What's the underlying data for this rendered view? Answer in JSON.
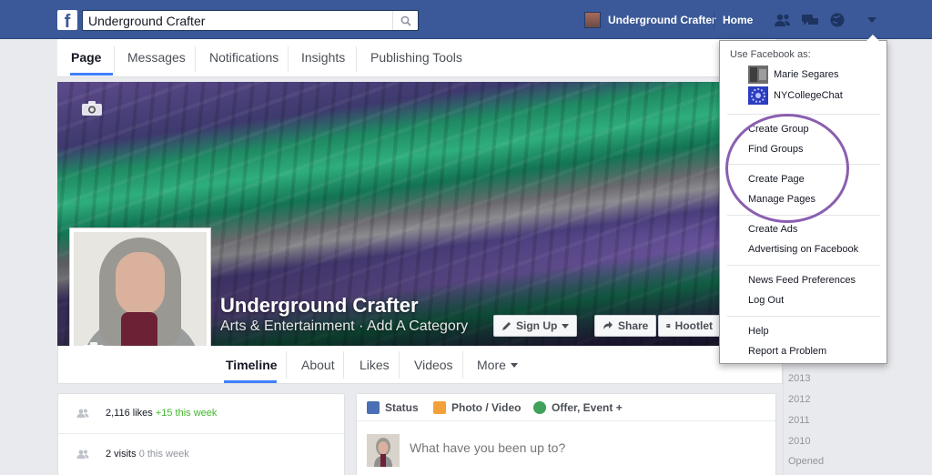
{
  "topbar": {
    "logo_letter": "f",
    "search_value": "Underground Crafter",
    "profile_name": "Underground Crafter",
    "home_label": "Home"
  },
  "page_tabs": [
    "Page",
    "Messages",
    "Notifications",
    "Insights",
    "Publishing Tools"
  ],
  "cover": {
    "page_name": "Underground Crafter",
    "category": "Arts & Entertainment · Add A Category",
    "signup_label": "Sign Up",
    "share_label": "Share",
    "hootlet_label": "Hootlet"
  },
  "timeline_tabs": [
    "Timeline",
    "About",
    "Likes",
    "Videos",
    "More"
  ],
  "stats": {
    "likes": "2,116 likes",
    "likes_delta": "+15 this week",
    "visits": "2 visits",
    "visits_delta": "0 this week"
  },
  "composer": {
    "tab_status": "Status",
    "tab_photo": "Photo / Video",
    "tab_offer": "Offer, Event +",
    "placeholder": "What have you been up to?"
  },
  "years": [
    "2013",
    "2012",
    "2011",
    "2010",
    "Opened"
  ],
  "dropdown": {
    "heading": "Use Facebook as:",
    "accounts": [
      "Marie Segares",
      "NYCollegeChat"
    ],
    "group1": [
      "Create Group",
      "Find Groups"
    ],
    "group2": [
      "Create Page",
      "Manage Pages"
    ],
    "group3": [
      "Create Ads",
      "Advertising on Facebook"
    ],
    "group4": [
      "News Feed Preferences",
      "Log Out"
    ],
    "group5": [
      "Help",
      "Report a Problem"
    ]
  },
  "colors": {
    "brand_blue": "#3b5998",
    "link_blue": "#4080ff",
    "highlight_circle": "#8a5fb0",
    "delta_green": "#42b72a"
  }
}
